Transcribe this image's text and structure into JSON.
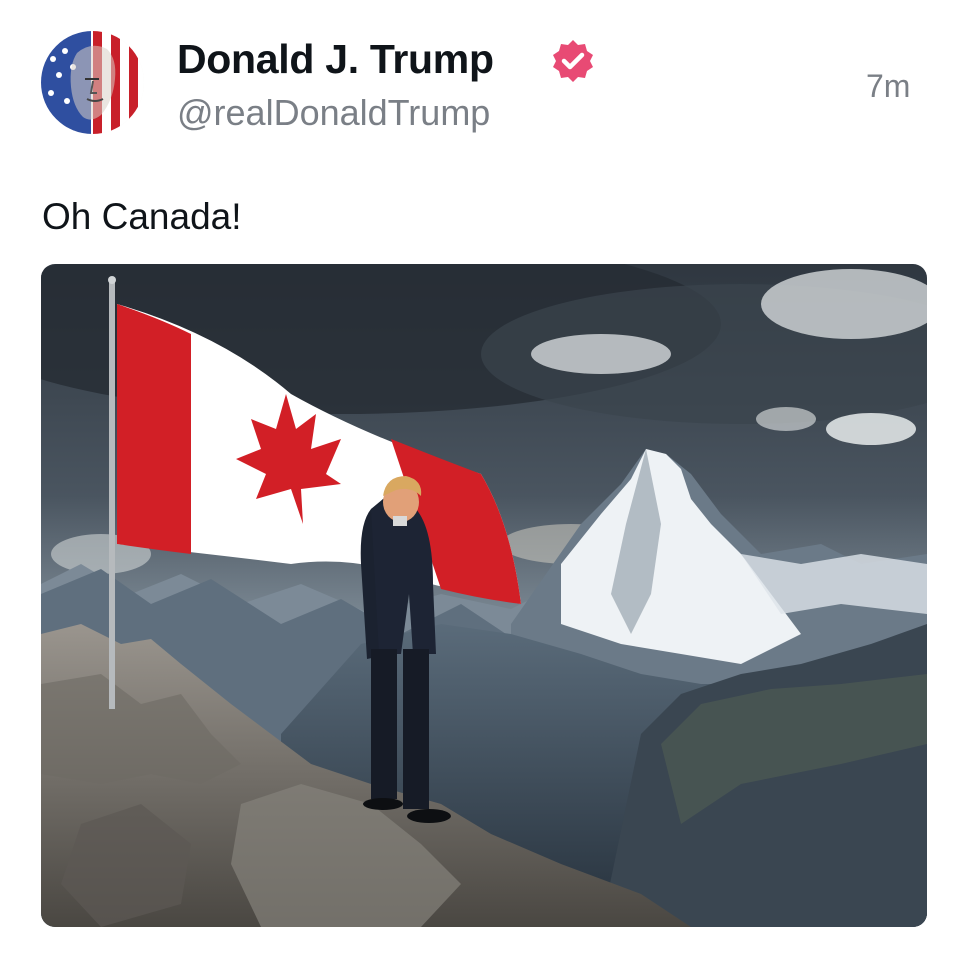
{
  "post": {
    "author": {
      "display_name": "Donald J. Trump",
      "handle": "@realDonaldTrump",
      "verified": true,
      "avatar_icon": "flag-portrait-avatar"
    },
    "timestamp": "7m",
    "text": "Oh Canada!",
    "media": {
      "type": "image",
      "subject_icon": "canadian-flag-mountain-image"
    }
  },
  "colors": {
    "name_text": "#0f1419",
    "secondary_text": "#7a7f86",
    "verified_badge": "#e84a74",
    "flag_red": "#d21f26"
  }
}
